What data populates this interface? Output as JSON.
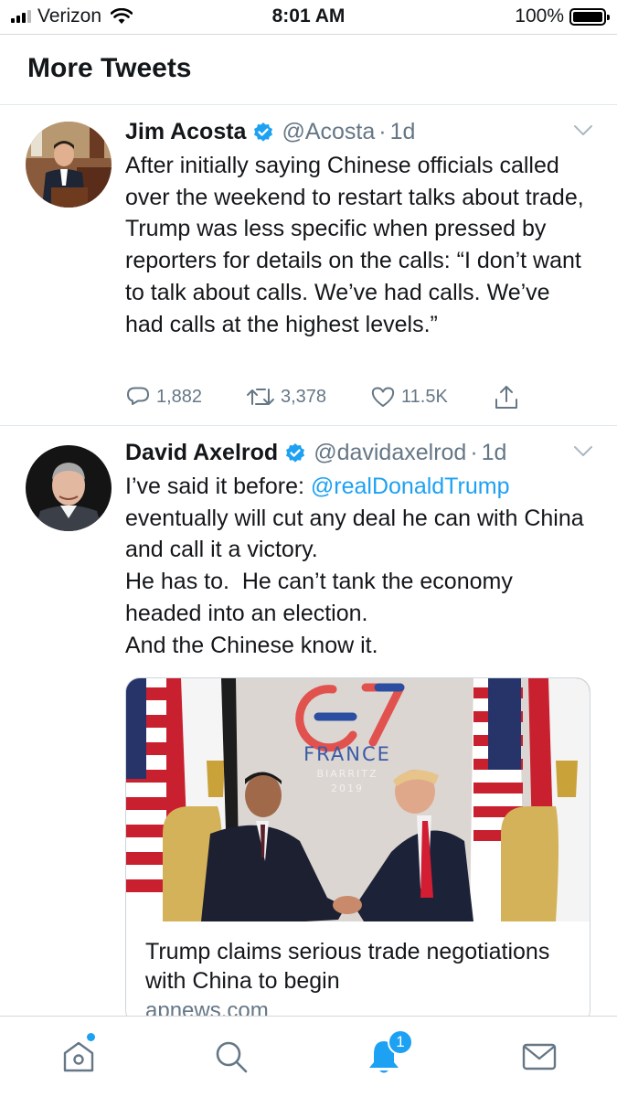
{
  "status_bar": {
    "carrier": "Verizon",
    "time": "8:01 AM",
    "battery": "100%"
  },
  "header": {
    "title": "More Tweets"
  },
  "tweets": [
    {
      "name": "Jim Acosta",
      "handle": "@Acosta",
      "separator": "·",
      "time": "1d",
      "text": "After initially saying Chinese officials called over the weekend to restart talks about trade, Trump was less specific when pressed by reporters for details on the calls: “I don’t want to talk about calls. We’ve had calls. We’ve had calls at the highest levels.”",
      "replies": "1,882",
      "retweets": "3,378",
      "likes": "11.5K"
    },
    {
      "name": "David Axelrod",
      "handle": "@davidaxelrod",
      "separator": "·",
      "time": "1d",
      "text_before": "I’ve said it before: ",
      "mention": "@realDonaldTrump",
      "text_after": "\neventually will cut any deal he can with China and call it a victory.\nHe has to.  He can’t tank the economy headed into an election.\nAnd the Chinese know it.",
      "card": {
        "image_text_main": "FRANCE",
        "image_text_city": "BIARRITZ",
        "image_text_year": "2019",
        "title": "Trump claims serious trade negotiations with China to begin",
        "domain": "apnews.com"
      }
    }
  ],
  "tabbar": {
    "notifications_badge": "1"
  },
  "colors": {
    "accent": "#1da1f2",
    "text_primary": "#14171a",
    "text_secondary": "#657786",
    "divider": "#e1e8ed"
  },
  "icons": [
    "signal-icon",
    "wifi-icon",
    "battery-icon",
    "verified-icon",
    "caret-down-icon",
    "reply-icon",
    "retweet-icon",
    "like-icon",
    "share-icon",
    "home-icon",
    "search-icon",
    "notifications-icon",
    "messages-icon"
  ]
}
